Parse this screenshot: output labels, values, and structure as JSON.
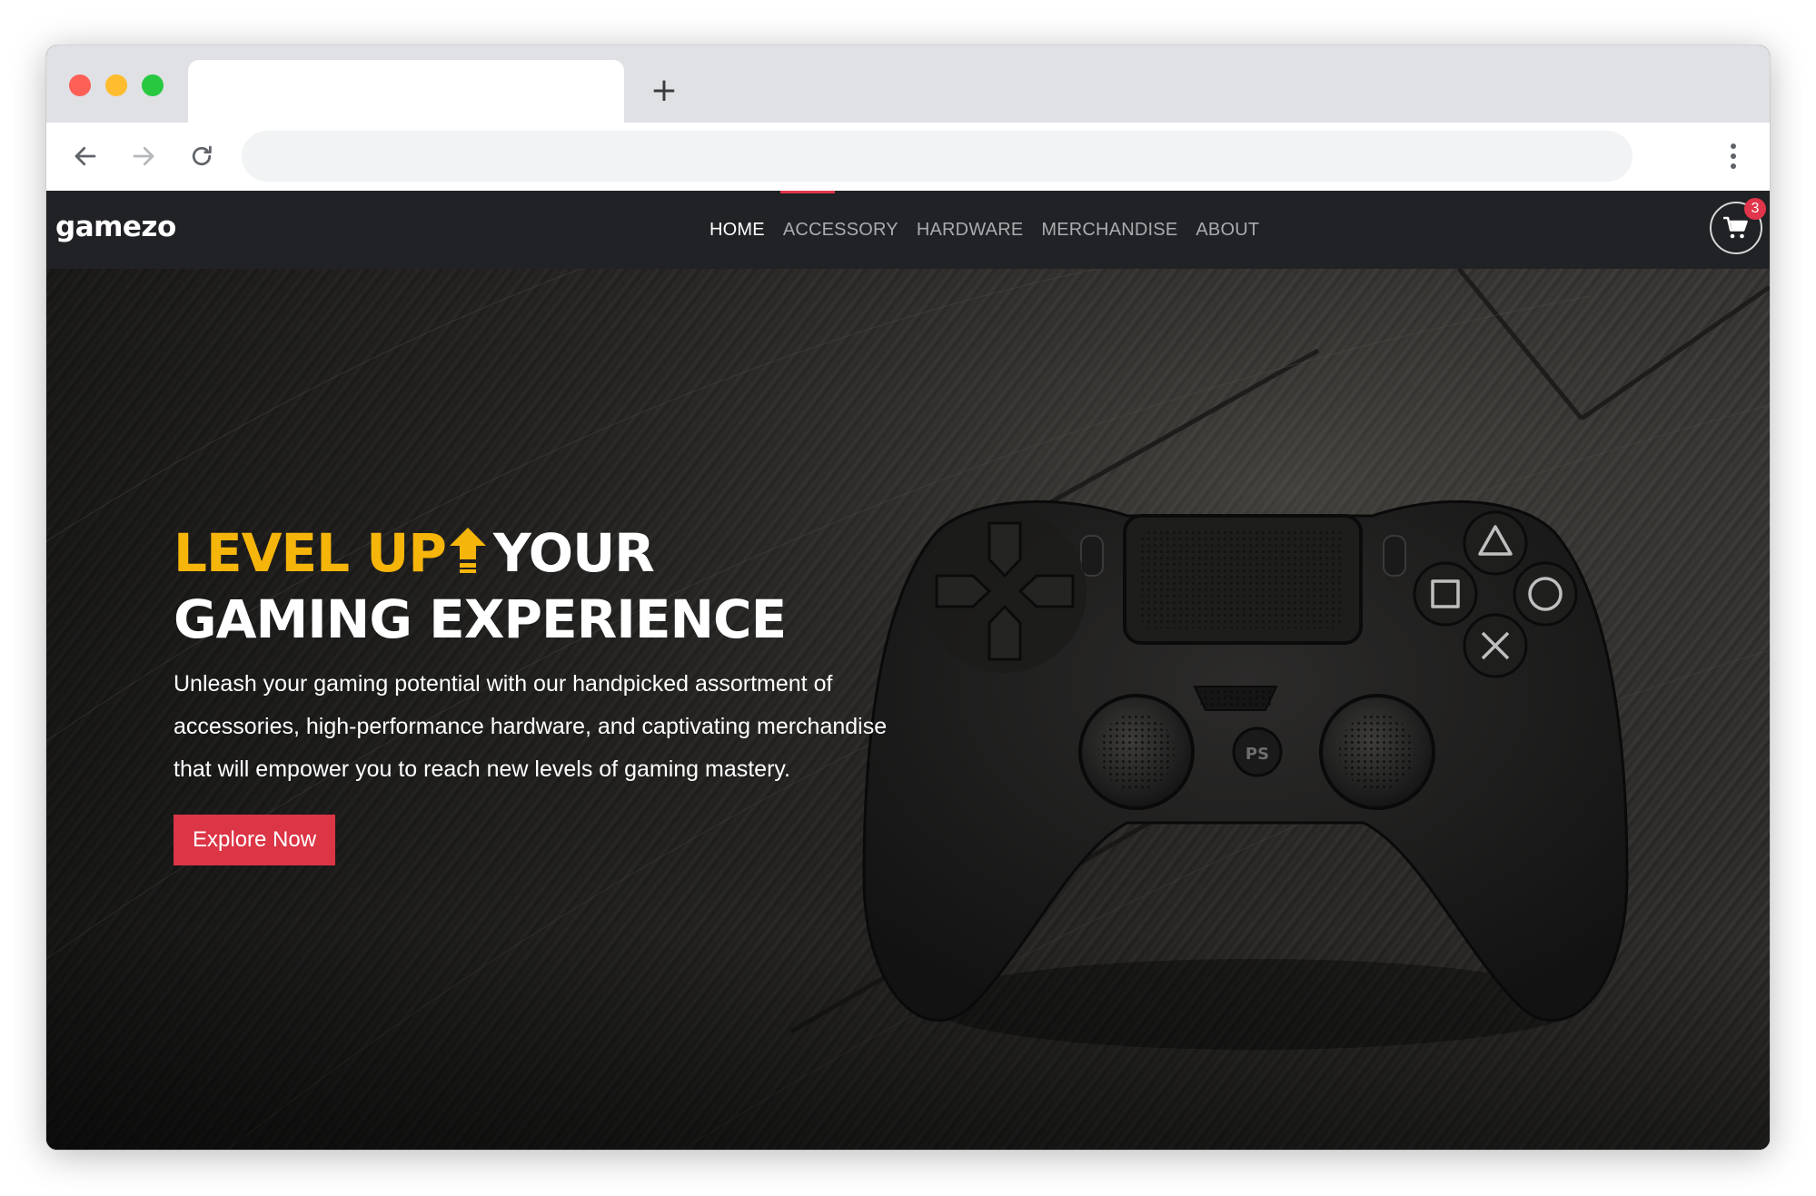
{
  "browser": {
    "new_tab_symbol": "+",
    "address_value": ""
  },
  "site": {
    "logo": "gamezo",
    "nav": [
      {
        "label": "HOME",
        "active": true
      },
      {
        "label": "ACCESSORY",
        "active": false
      },
      {
        "label": "HARDWARE",
        "active": false
      },
      {
        "label": "MERCHANDISE",
        "active": false
      },
      {
        "label": "ABOUT",
        "active": false
      }
    ],
    "cart_count": "3"
  },
  "hero": {
    "headline_accent": "LEVEL UP",
    "headline_rest_line1": "YOUR",
    "headline_line2": "GAMING EXPERIENCE",
    "lead": "Unleash your gaming potential with our handpicked assortment of accessories, high-performance hardware, and captivating merchandise that will empower you to reach new levels of gaming mastery.",
    "cta_label": "Explore Now"
  },
  "colors": {
    "accent_yellow": "#f5b50a",
    "brand_red": "#dc3545",
    "nav_bg": "#202225"
  },
  "icons": {
    "back": "arrow-left-icon",
    "forward": "arrow-right-icon",
    "reload": "reload-icon",
    "menu": "kebab-menu-icon",
    "cart": "cart-icon",
    "level_up": "up-arrow-icon"
  }
}
